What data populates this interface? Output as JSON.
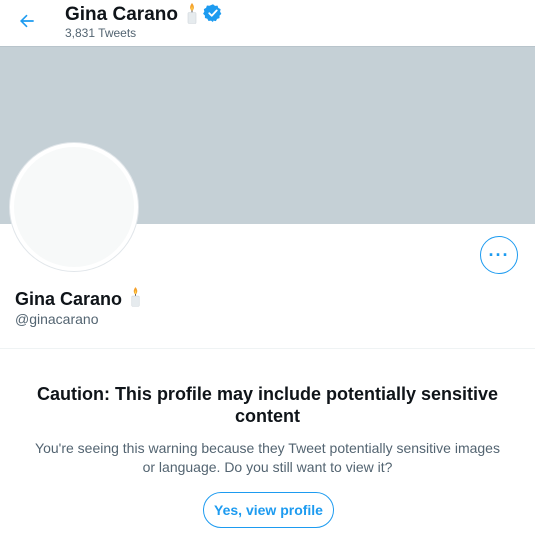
{
  "header": {
    "back_icon": "arrow-left-icon",
    "title": "Gina Carano",
    "title_emoji": "candle-icon",
    "verified_icon": "verified-badge-icon",
    "tweet_count": "3,831 Tweets"
  },
  "profile": {
    "name": "Gina Carano",
    "name_emoji": "candle-icon",
    "handle": "@ginacarano",
    "more_icon": "more-horizontal-icon",
    "more_label": "···"
  },
  "warning": {
    "title": "Caution: This profile may include potentially sensitive content",
    "body": "You're seeing this warning because they Tweet potentially sensitive images or language. Do you still want to view it?",
    "button_label": "Yes, view profile"
  },
  "colors": {
    "accent": "#1d9bf0",
    "banner": "#c5d0d6",
    "secondary_text": "#536471"
  }
}
